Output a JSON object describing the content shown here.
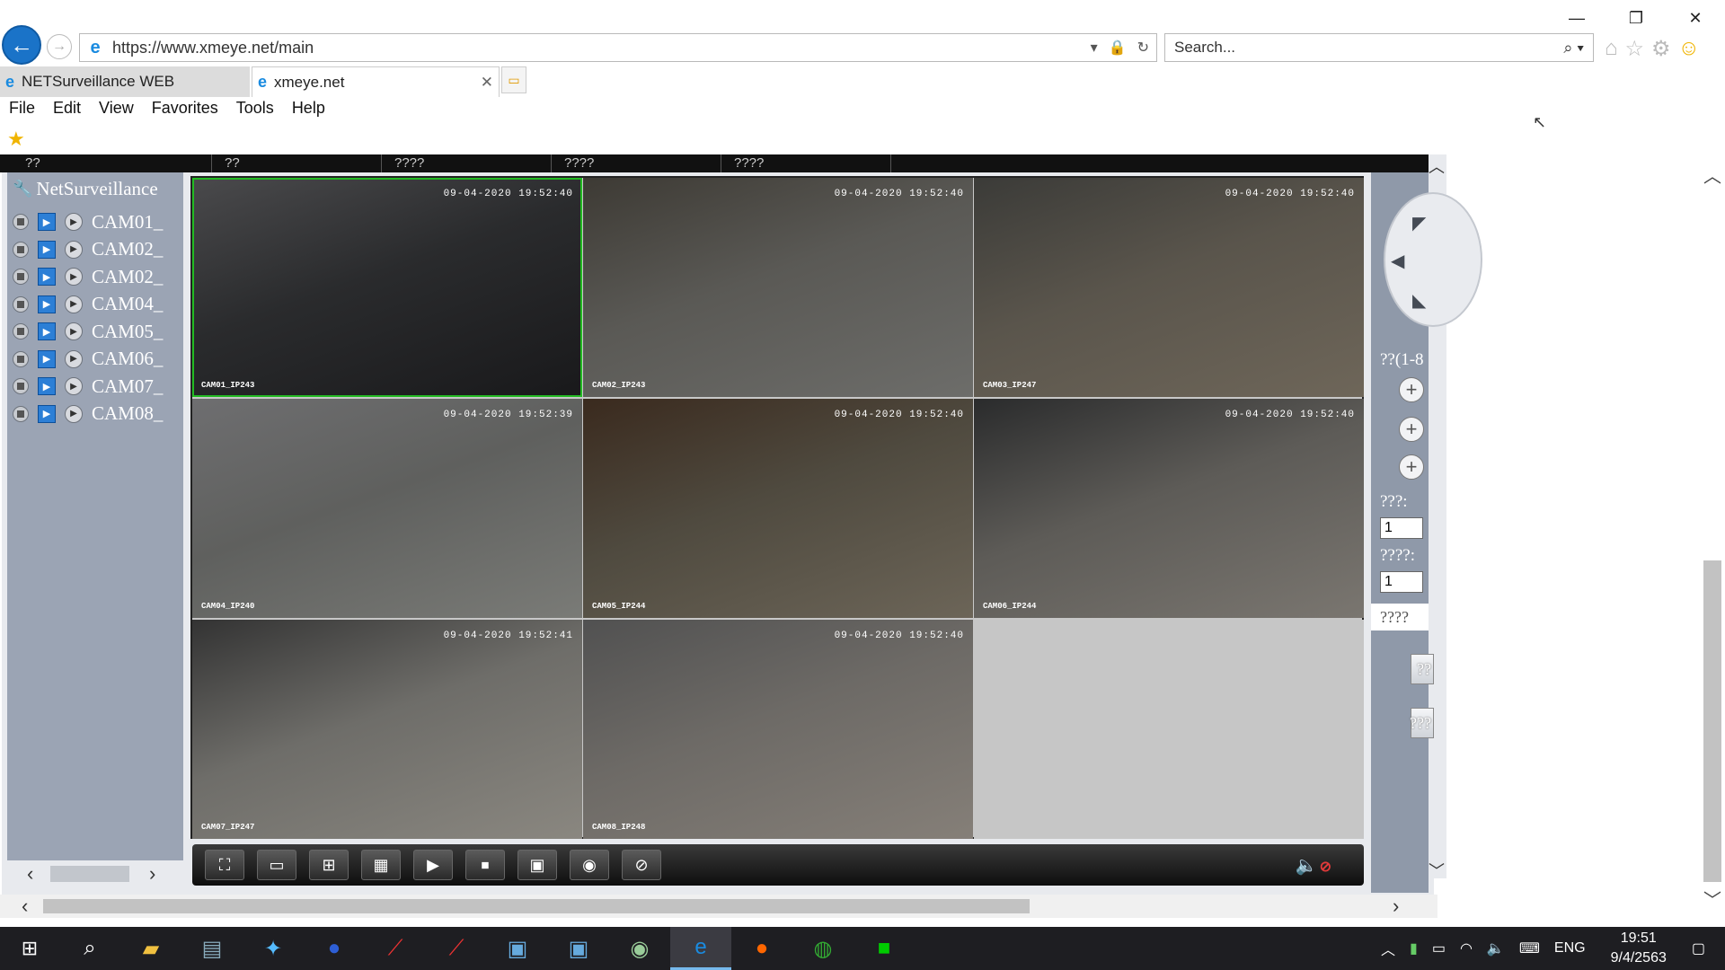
{
  "browser": {
    "url": "https://www.xmeye.net/main",
    "search_placeholder": "Search...",
    "tabs": [
      {
        "label": "NETSurveillance WEB"
      },
      {
        "label": "xmeye.net"
      }
    ],
    "menu": [
      "File",
      "Edit",
      "View",
      "Favorites",
      "Tools",
      "Help"
    ]
  },
  "plugin": {
    "top_strip": [
      "??",
      "??",
      "????",
      "????",
      "????"
    ],
    "tree_title": "NetSurveillance",
    "cameras": [
      "CAM01_",
      "CAM02_",
      "CAM02_",
      "CAM04_",
      "CAM05_",
      "CAM06_",
      "CAM07_",
      "CAM08_"
    ],
    "tiles": [
      {
        "timestamp": "09-04-2020 19:52:40",
        "name": "CAM01_IP243",
        "colors": [
          "#4a4a4c",
          "#2a2b2d",
          "#19191b"
        ]
      },
      {
        "timestamp": "09-04-2020 19:52:40",
        "name": "CAM02_IP243",
        "colors": [
          "#3d3a34",
          "#5a5955",
          "#6d6d6a"
        ]
      },
      {
        "timestamp": "09-04-2020 19:52:40",
        "name": "CAM03_IP247",
        "colors": [
          "#3b3b38",
          "#5a554c",
          "#6e6659"
        ]
      },
      {
        "timestamp": "09-04-2020 19:52:39",
        "name": "CAM04_IP240",
        "colors": [
          "#6e6e70",
          "#5f605e",
          "#7a7b77"
        ]
      },
      {
        "timestamp": "09-04-2020 19:52:40",
        "name": "CAM05_IP244",
        "colors": [
          "#3a2a1e",
          "#4f4a3f",
          "#6c6558"
        ]
      },
      {
        "timestamp": "09-04-2020 19:52:40",
        "name": "CAM06_IP244",
        "colors": [
          "#2a2b2c",
          "#5d5b57",
          "#7a7670"
        ]
      },
      {
        "timestamp": "09-04-2020 19:52:41",
        "name": "CAM07_IP247",
        "colors": [
          "#333",
          "#6e6d69",
          "#8a8780"
        ]
      },
      {
        "timestamp": "09-04-2020 19:52:40",
        "name": "CAM08_IP248",
        "colors": [
          "#515151",
          "#6d6a66",
          "#857f78"
        ]
      }
    ],
    "ptz": {
      "label1": "??(1-8",
      "label2": "???:",
      "value1": "1",
      "label3": "????:",
      "value2": "1",
      "wide_label": "????",
      "btn1": "??",
      "btn2": "???"
    }
  },
  "taskbar": {
    "lang": "ENG",
    "time": "19:51",
    "date": "9/4/2563"
  }
}
